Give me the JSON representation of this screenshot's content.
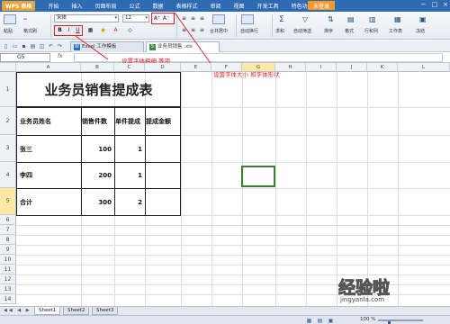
{
  "menubar": {
    "app_name": "WPS 表格",
    "items": [
      "开始",
      "插入",
      "页面布局",
      "公式",
      "数据",
      "表格样式",
      "审阅",
      "视图",
      "开发工具",
      "特色功能"
    ],
    "login": "未登录"
  },
  "ribbon": {
    "paste": "粘贴",
    "format_painter": "格式刷",
    "font_name": "宋体",
    "font_size": "12",
    "grow_font": "A⁺",
    "shrink_font": "A⁻",
    "bold": "B",
    "italic": "I",
    "underline": "U",
    "merge_center": "合并居中",
    "wrap": "自动换行",
    "sum": "求和",
    "filter": "自动筛选",
    "sort": "排序",
    "format": "格式",
    "rows_cols": "行和列",
    "worksheet": "工作表",
    "freeze": "冻结"
  },
  "tabs": {
    "tab1": "Excel 工作模板",
    "tab2": "业务员销售 .xls"
  },
  "formula": {
    "cell_ref": "G5",
    "fx": "fx",
    "content": ""
  },
  "annotations": {
    "font_bold": "设置字体粗细  等项",
    "font_size_shape": "设置字体大小  和字体形状"
  },
  "columns": [
    "A",
    "B",
    "C",
    "D",
    "E",
    "F",
    "G",
    "H",
    "I",
    "J",
    "K",
    "L"
  ],
  "rows": [
    "1",
    "2",
    "3",
    "4",
    "5",
    "6",
    "7",
    "8",
    "9",
    "10",
    "11",
    "12",
    "13",
    "14",
    "15",
    "16",
    "17"
  ],
  "sheet": {
    "title": "业务员销售提成表",
    "headers": [
      "业务员姓名",
      "销售件数",
      "单件提成",
      "提成金额"
    ],
    "data": [
      [
        "张三",
        "100",
        "1",
        ""
      ],
      [
        "李四",
        "200",
        "1",
        ""
      ],
      [
        "合计",
        "300",
        "2",
        ""
      ]
    ]
  },
  "sheet_tabs": [
    "Sheet1",
    "Sheet2",
    "Sheet3"
  ],
  "status": {
    "zoom": "100 %",
    "zoom_level": 1.0
  },
  "watermark": {
    "text": "经验啦",
    "url": "jingyanla.com"
  }
}
